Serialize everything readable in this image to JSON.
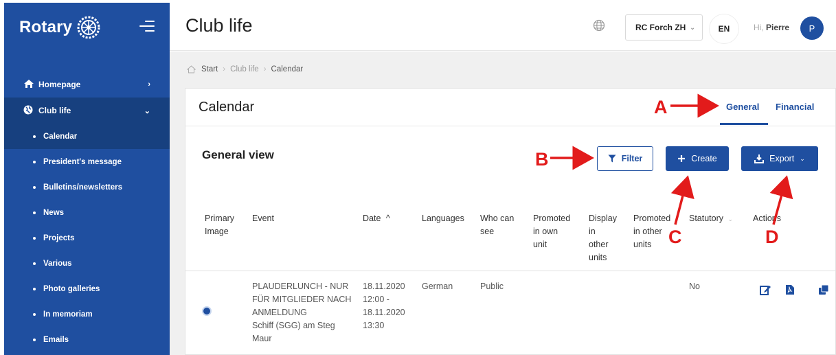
{
  "sidebar": {
    "logo_text": "Rotary",
    "items": [
      {
        "label": "Homepage",
        "icon": "home-icon",
        "chevron": "›"
      },
      {
        "label": "Club life",
        "icon": "globe-icon",
        "chevron": "⌄"
      }
    ],
    "sub_items": [
      {
        "label": "Calendar"
      },
      {
        "label": "President's message"
      },
      {
        "label": "Bulletins/newsletters"
      },
      {
        "label": "News"
      },
      {
        "label": "Projects"
      },
      {
        "label": "Various"
      },
      {
        "label": "Photo galleries"
      },
      {
        "label": "In memoriam"
      },
      {
        "label": "Emails"
      }
    ]
  },
  "header": {
    "title": "Club life",
    "club": "RC Forch ZH",
    "language": "EN",
    "greeting": "Hi,",
    "user": "Pierre",
    "avatar_initial": "P"
  },
  "breadcrumb": {
    "items": [
      "Start",
      "Club life",
      "Calendar"
    ]
  },
  "card": {
    "title": "Calendar",
    "tabs": [
      "General",
      "Financial"
    ],
    "view_title": "General view",
    "filter_label": "Filter",
    "create_label": "Create",
    "export_label": "Export"
  },
  "table": {
    "headers": {
      "primary_image": [
        "Primary",
        "Image"
      ],
      "event": "Event",
      "date": "Date",
      "languages": "Languages",
      "who_can_see": [
        "Who can",
        "see"
      ],
      "promoted_own": [
        "Promoted",
        "in own",
        "unit"
      ],
      "display_other": [
        "Display",
        "in",
        "other",
        "units"
      ],
      "promoted_other": [
        "Promoted",
        "in other",
        "units"
      ],
      "statutory": "Statutory",
      "actions": "Actions"
    },
    "rows": [
      {
        "event": [
          "PLAUDERLUNCH - NUR",
          "FÜR MITGLIEDER NACH",
          "ANMELDUNG",
          "Schiff (SGG) am Steg",
          "Maur"
        ],
        "date": [
          "18.11.2020",
          "12:00 -",
          "18.11.2020",
          "13:30"
        ],
        "languages": "German",
        "who_can_see": "Public",
        "statutory": "No"
      }
    ]
  },
  "annotations": {
    "a": "A",
    "b": "B",
    "c": "C",
    "d": "D"
  },
  "colors": {
    "brand_blue": "#1f4fa0",
    "annotation_red": "#e21b1b"
  }
}
